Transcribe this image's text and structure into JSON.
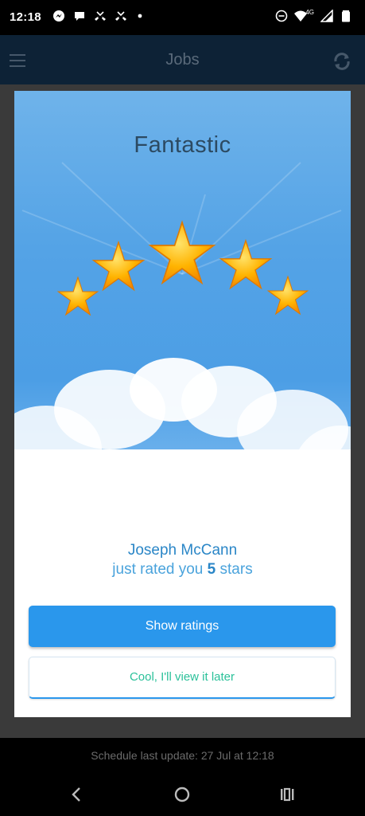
{
  "status_bar": {
    "time": "12:18",
    "network_label": "4G",
    "notification_icons": [
      "messenger-icon",
      "chat-bubble-icon",
      "missed-call-icon",
      "missed-call-icon",
      "dot-icon"
    ],
    "system_icons": [
      "do-not-disturb-icon",
      "wifi-icon",
      "signal-icon",
      "battery-icon"
    ]
  },
  "app_bar": {
    "title": "Jobs",
    "menu_icon": "hamburger-menu-icon",
    "refresh_icon": "refresh-icon"
  },
  "dialog": {
    "title": "Fantastic",
    "rating_value": 5,
    "rating_max": 5,
    "rater_name": "Joseph McCann",
    "rated_prefix": "just rated you",
    "rated_count": "5",
    "rated_suffix": "stars",
    "primary_button": "Show ratings",
    "secondary_button": "Cool, I'll view it later",
    "colors": {
      "primary": "#2a97ec",
      "secondary_text": "#2bc19a",
      "star": "#ffb300"
    }
  },
  "footer": {
    "schedule_text": "Schedule last update: 27 Jul at 12:18"
  },
  "nav_bar": {
    "icons": [
      "back-icon",
      "home-icon",
      "recents-icon"
    ]
  }
}
